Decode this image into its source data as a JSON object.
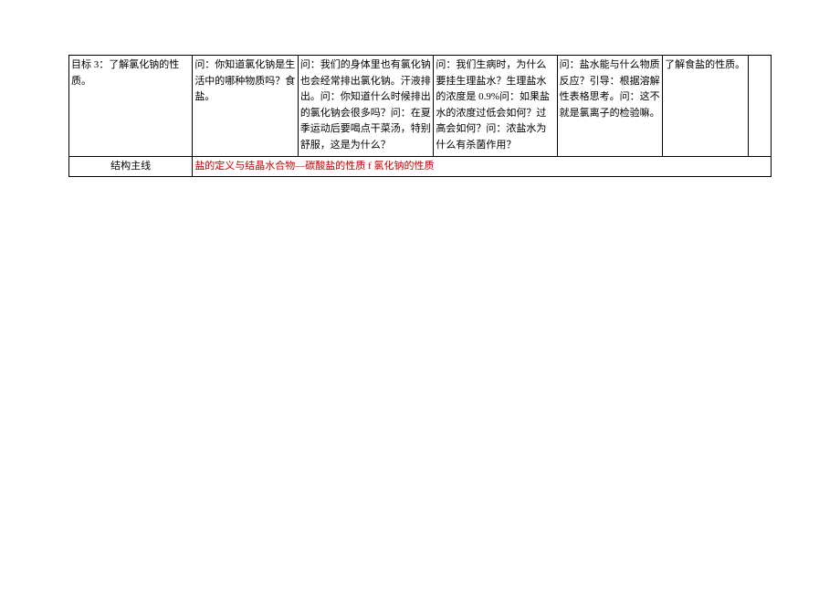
{
  "row1": {
    "col1": "目标 3：了解氯化钠的性质。",
    "col2": "问：你知道氯化钠是生活中的哪种物质吗？食盐。",
    "col3": "问：我们的身体里也有氯化钠也会经常排出氯化钠。汗液排出。问：你知道什么时候排出的氯化钠会很多吗？问：在夏季运动后要喝点干菜汤，特别舒服，这是为什么？",
    "col4": "问：我们生病时，为什么要挂生理盐水？生理盐水的浓度是 0.9%问：如果盐水的浓度过低会如何？过高会如何？问：浓盐水为什么有杀菌作用？",
    "col5": "问：盐水能与什么物质反应？引导：根据溶解性表格思考。问：这不就是氯离子的检验嘛。",
    "col6": "了解食盐的性质。",
    "col7": ""
  },
  "row2": {
    "label": "结构主线",
    "content": "盐的定义与结晶水合物—碳酸盐的性质 f 氯化钠的性质"
  }
}
